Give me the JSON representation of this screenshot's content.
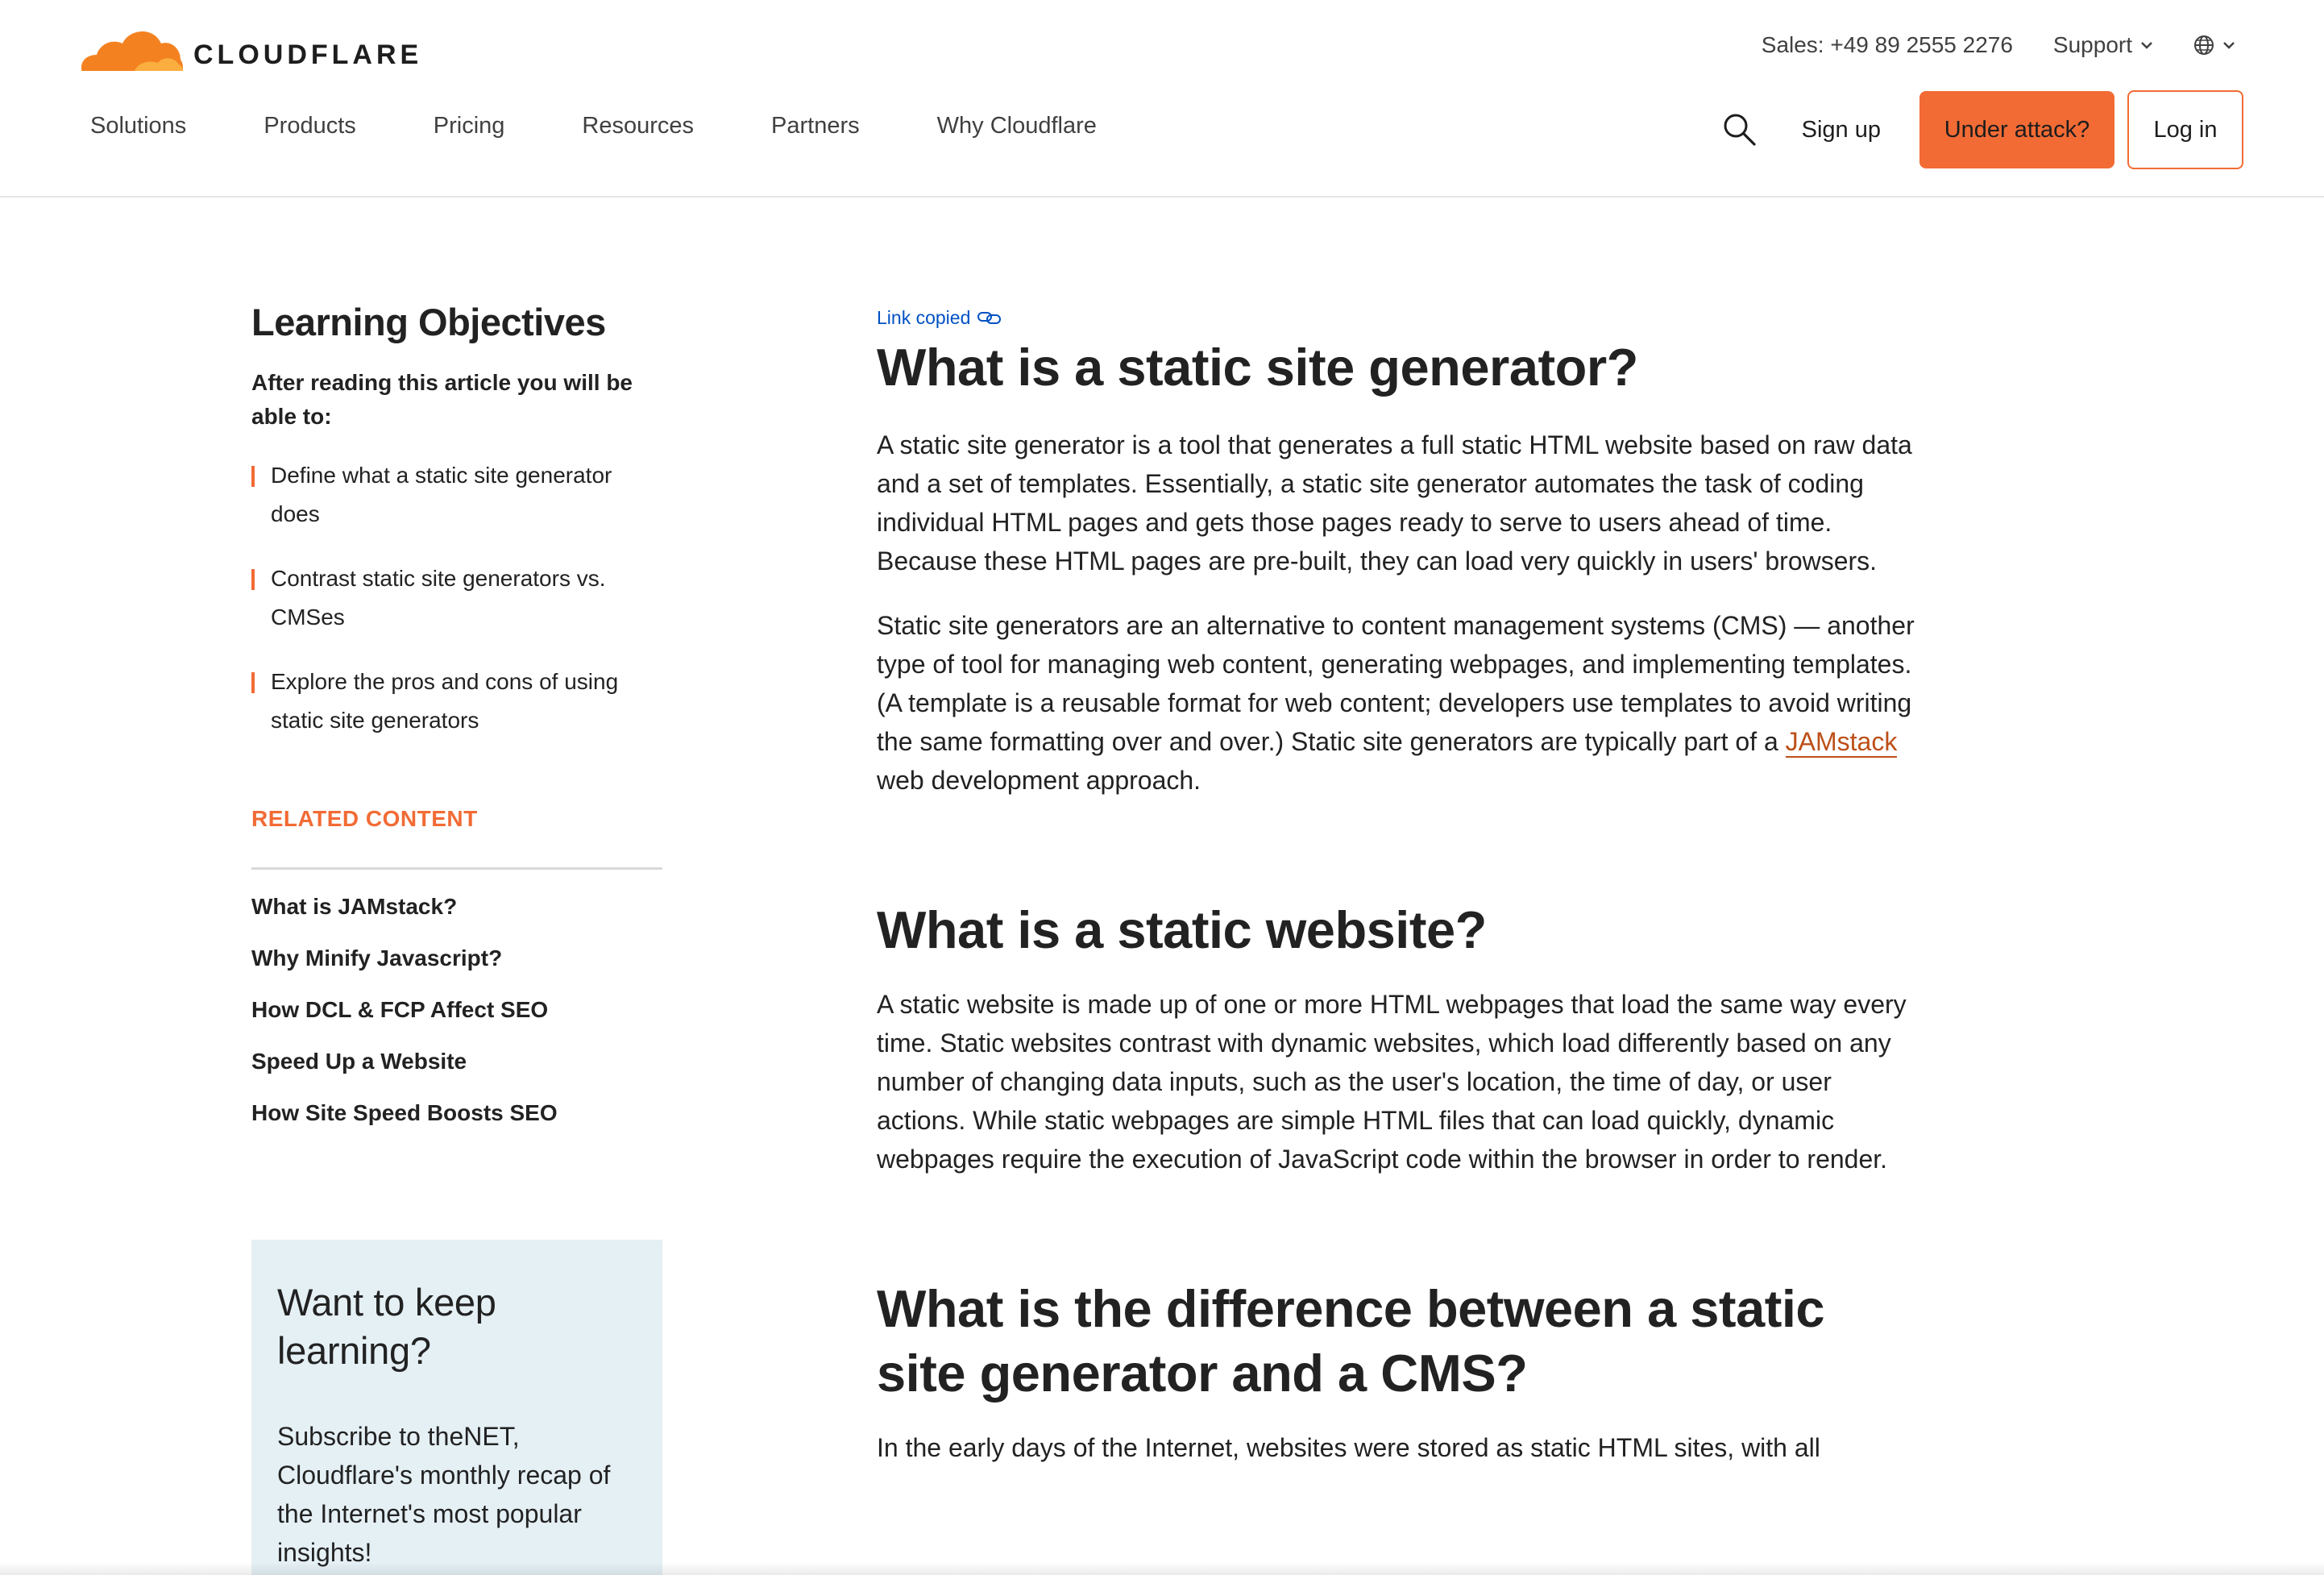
{
  "brand": {
    "name": "CLOUDFLARE",
    "accent": "#f26b35",
    "link_blue": "#0051c3"
  },
  "utility": {
    "sales": "Sales: +49 89 2555 2276",
    "support": "Support",
    "language_icon": "globe-icon"
  },
  "nav": {
    "items": [
      {
        "label": "Solutions"
      },
      {
        "label": "Products"
      },
      {
        "label": "Pricing"
      },
      {
        "label": "Resources"
      },
      {
        "label": "Partners"
      },
      {
        "label": "Why Cloudflare"
      }
    ],
    "search_icon": "search-icon",
    "sign_up": "Sign up",
    "under_attack": "Under attack?",
    "log_in": "Log in"
  },
  "sidebar": {
    "title": "Learning Objectives",
    "intro": "After reading this article you will be able to:",
    "objectives": [
      {
        "text": "Define what a static site generator does"
      },
      {
        "text": "Contrast static site generators vs. CMSes"
      },
      {
        "text": "Explore the pros and cons of using static site generators"
      }
    ],
    "related_title": "RELATED CONTENT",
    "related": [
      {
        "label": "What is JAMstack?"
      },
      {
        "label": "Why Minify Javascript?"
      },
      {
        "label": "How DCL & FCP Affect SEO"
      },
      {
        "label": "Speed Up a Website"
      },
      {
        "label": "How Site Speed Boosts SEO"
      }
    ]
  },
  "promo": {
    "title": "Want to keep learning?",
    "text": "Subscribe to theNET, Cloudflare's monthly recap of the Internet's most popular insights!"
  },
  "article": {
    "link_copied": "Link copied",
    "h1": "What is a static site generator?",
    "p1": "A static site generator is a tool that generates a full static HTML website based on raw data and a set of templates. Essentially, a static site generator automates the task of coding individual HTML pages and gets those pages ready to serve to users ahead of time. Because these HTML pages are pre-built, they can load very quickly in users' browsers.",
    "p2_before": "Static site generators are an alternative to content management systems (CMS) — another type of tool for managing web content, generating webpages, and implementing templates. (A template is a reusable format for web content; developers use templates to avoid writing the same formatting over and over.) Static site generators are typically part of a ",
    "p2_link": "JAMstack",
    "p2_after": " web development approach.",
    "h2_static_website": "What is a static website?",
    "p3": "A static website is made up of one or more HTML webpages that load the same way every time. Static websites contrast with dynamic websites, which load differently based on any number of changing data inputs, such as the user's location, the time of day, or user actions. While static webpages are simple HTML files that can load quickly, dynamic webpages require the execution of JavaScript code within the browser in order to render.",
    "h2_difference": "What is the difference between a static site generator and a CMS?",
    "p4": "In the early days of the Internet, websites were stored as static HTML sites, with all"
  }
}
